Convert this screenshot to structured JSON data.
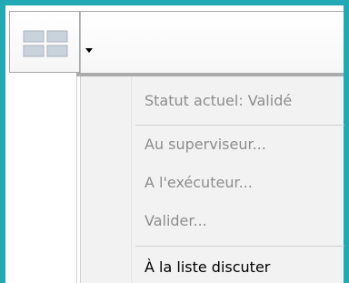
{
  "toolbar": {
    "view_button_icon": "grid-view-icon",
    "dropdown_icon": "chevron-down-icon"
  },
  "menu": {
    "items": [
      {
        "label": "Statut actuel: Validé",
        "enabled": false
      },
      {
        "label": "Au superviseur...",
        "enabled": false
      },
      {
        "label": "A l'exécuteur...",
        "enabled": false
      },
      {
        "label": "Valider...",
        "enabled": false
      },
      {
        "label": "À la liste discuter",
        "enabled": true
      }
    ]
  },
  "colors": {
    "frame_border": "#21a9b5",
    "menu_background": "#f2f2f2",
    "disabled_text": "#8d8d8d",
    "enabled_text": "#000000",
    "icon_fill": "#c9d3dc"
  }
}
